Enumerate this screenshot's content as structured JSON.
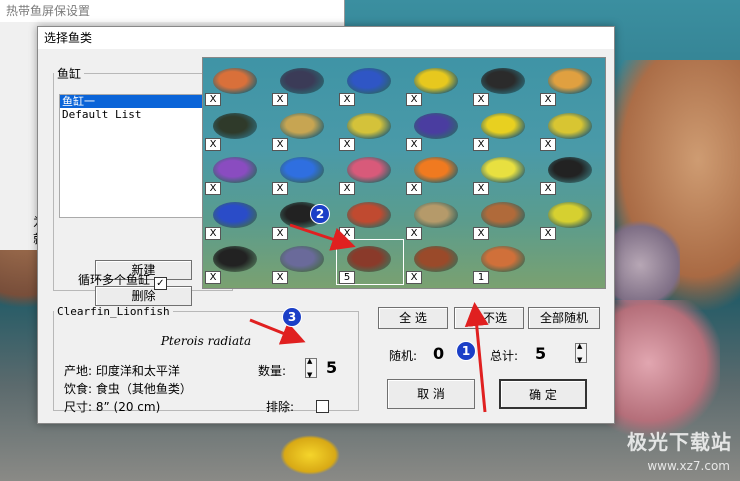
{
  "back_window": {
    "title": "热带鱼屏保设置",
    "fragments": [
      "为",
      "就"
    ]
  },
  "dialog": {
    "title": "选择鱼类"
  },
  "tank": {
    "legend": "鱼缸",
    "items": [
      {
        "label": "鱼缸一",
        "selected": true
      },
      {
        "label": "Default List",
        "selected": false
      }
    ],
    "new_label": "新建",
    "delete_label": "删除",
    "loop_label": "循环多个鱼缸",
    "loop_checked": "✓"
  },
  "fish_grid": {
    "cells": [
      {
        "label": "X",
        "color": "#d9703a"
      },
      {
        "label": "X",
        "color": "#3b3b57"
      },
      {
        "label": "X",
        "color": "#2f56c5"
      },
      {
        "label": "X",
        "color": "#e7c81e"
      },
      {
        "label": "X",
        "color": "#2b2b2b"
      },
      {
        "label": "X",
        "color": "#e0a040"
      },
      {
        "label": "X",
        "color": "#2f3a2a"
      },
      {
        "label": "X",
        "color": "#c7a552"
      },
      {
        "label": "X",
        "color": "#d4c23a"
      },
      {
        "label": "X",
        "color": "#4a3da0"
      },
      {
        "label": "X",
        "color": "#e8d020"
      },
      {
        "label": "X",
        "color": "#d8c532"
      },
      {
        "label": "X",
        "color": "#8a4cc0"
      },
      {
        "label": "X",
        "color": "#2f6fe0"
      },
      {
        "label": "X",
        "color": "#d85a7a"
      },
      {
        "label": "X",
        "color": "#f07a20"
      },
      {
        "label": "X",
        "color": "#e8e040"
      },
      {
        "label": "X",
        "color": "#222222"
      },
      {
        "label": "X",
        "color": "#2a4cc8"
      },
      {
        "label": "X",
        "color": "#222222"
      },
      {
        "label": "X",
        "color": "#c04a30"
      },
      {
        "label": "X",
        "color": "#b59a6a"
      },
      {
        "label": "X",
        "color": "#b06a3a"
      },
      {
        "label": "X",
        "color": "#d6d030"
      },
      {
        "label": "X",
        "color": "#222222"
      },
      {
        "label": "X",
        "color": "#6a6a9a"
      },
      {
        "label": "5",
        "color": "#8a3a2a"
      },
      {
        "label": "X",
        "color": "#9a4a2a"
      },
      {
        "label": "1",
        "color": "#d0703a"
      }
    ]
  },
  "info": {
    "legend": "Clearfin_Lionfish",
    "latin": "Pterois radiata",
    "origin": "产地: 印度洋和太平洋",
    "diet": "饮食: 食虫（其他鱼类）",
    "size": "尺寸: 8” (20 cm)",
    "qty_label": "数量:",
    "qty_value": "5",
    "exclude_label": "排除:"
  },
  "actions": {
    "select_all": "全  选",
    "select_none": "全不选",
    "random_all": "全部随机",
    "random_label": "随机:",
    "random_value": "0",
    "total_label": "总计:",
    "total_value": "5",
    "cancel": "取  消",
    "ok": "确  定"
  },
  "annotations": {
    "b1": "1",
    "b2": "2",
    "b3": "3",
    "arrow_color": "#e02020"
  },
  "watermark": {
    "name": "极光下载站",
    "url": "www.xz7.com"
  }
}
